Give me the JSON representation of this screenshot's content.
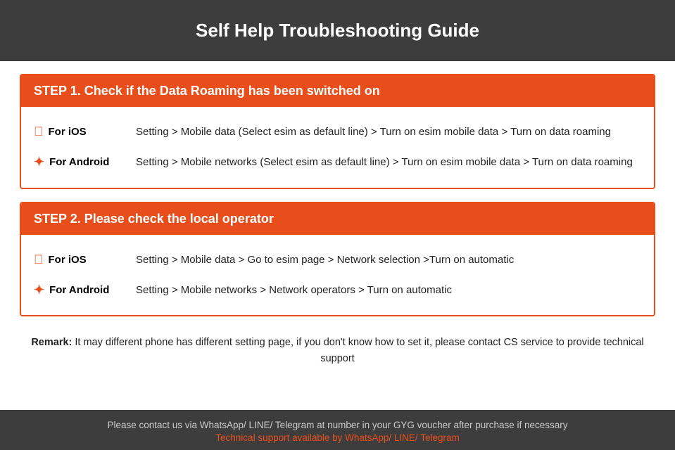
{
  "header": {
    "title": "Self Help Troubleshooting Guide"
  },
  "step1": {
    "heading": "STEP 1.  Check if the Data Roaming has been switched on",
    "ios_label": "For iOS",
    "ios_text": "Setting > Mobile data (Select esim as default line) > Turn on esim mobile data > Turn on data roaming",
    "android_label": "For Android",
    "android_text": "Setting > Mobile networks (Select esim as default line) > Turn on esim mobile data > Turn on data roaming"
  },
  "step2": {
    "heading": "STEP 2.  Please check the local operator",
    "ios_label": "For iOS",
    "ios_text": "Setting > Mobile data > Go to esim page > Network selection >Turn on automatic",
    "android_label": "For Android",
    "android_text": "Setting > Mobile networks > Network operators > Turn on automatic"
  },
  "remark": {
    "label": "Remark:",
    "text": "It may different phone has different setting page, if you don't know how to set it,  please contact CS service to provide technical support"
  },
  "footer": {
    "contact_text": "Please contact us via WhatsApp/ LINE/ Telegram at number in your GYG voucher after purchase if necessary",
    "support_text": "Technical support available by WhatsApp/ LINE/ Telegram"
  }
}
